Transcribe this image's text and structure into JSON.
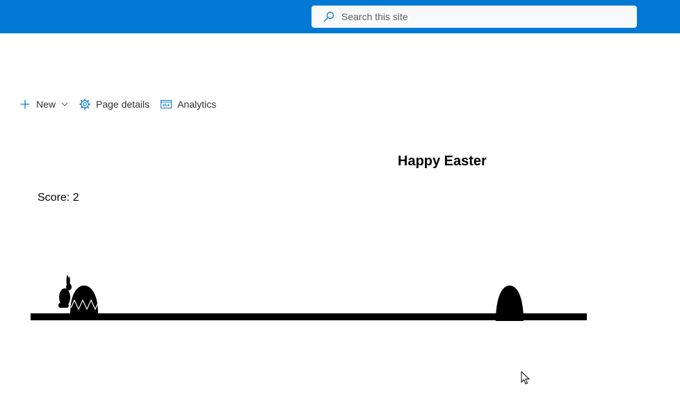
{
  "suitebar": {
    "background": "#0078d4"
  },
  "search": {
    "placeholder": "Search this site",
    "icon": "search-icon"
  },
  "commands": {
    "new_label": "New",
    "page_details_label": "Page details",
    "analytics_label": "Analytics",
    "accent": "#0078d4"
  },
  "game": {
    "title": "Happy Easter",
    "score_label": "Score:",
    "score_value": "2",
    "colors": {
      "foreground": "#000000",
      "background": "#ffffff"
    }
  }
}
